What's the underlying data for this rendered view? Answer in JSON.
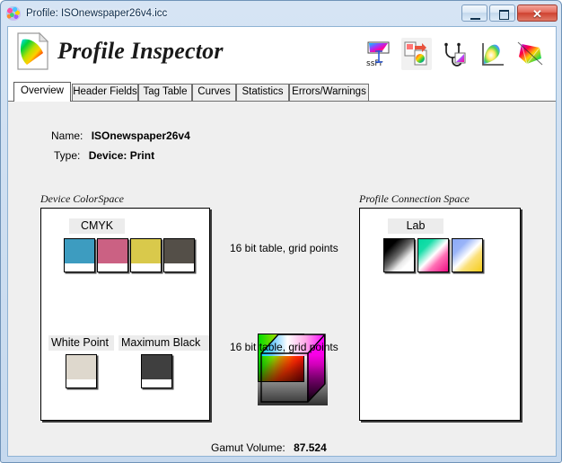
{
  "window": {
    "title": "Profile: ISOnewspaper26v4.icc",
    "icon": "brain-icon",
    "buttons": {
      "minimize": "minimize",
      "maximize": "maximize",
      "close": "✕"
    }
  },
  "header": {
    "app_title": "Profile Inspector",
    "logo_icon": "profile-document-gamut-icon",
    "toolbar": [
      {
        "name": "rgb-to-printer-icon",
        "label": "ssPr"
      },
      {
        "name": "profile-convert-icon",
        "label": ""
      },
      {
        "name": "stethoscope-inspect-icon",
        "label": ""
      },
      {
        "name": "chromaticity-plot-icon",
        "label": ""
      },
      {
        "name": "gamut-3d-icon",
        "label": ""
      }
    ]
  },
  "tabs": [
    {
      "label": "Overview",
      "active": true
    },
    {
      "label": "Header Fields",
      "active": false
    },
    {
      "label": "Tag Table",
      "active": false
    },
    {
      "label": "Curves",
      "active": false
    },
    {
      "label": "Statistics",
      "active": false
    },
    {
      "label": "Errors/Warnings",
      "active": false
    }
  ],
  "overview": {
    "fields": [
      {
        "key": "Name:",
        "value": "ISOnewspaper26v4"
      },
      {
        "key": "Type:",
        "value": "Device: Print"
      }
    ],
    "device_colorspace": {
      "group_label": "Device ColorSpace",
      "model_label": "CMYK",
      "channels": [
        {
          "name": "cyan-swatch",
          "color": "#3d9cc0"
        },
        {
          "name": "magenta-swatch",
          "color": "#cb6183"
        },
        {
          "name": "yellow-swatch",
          "color": "#d9c94b"
        },
        {
          "name": "black-swatch",
          "color": "#544f48"
        }
      ],
      "white_point": {
        "label": "White Point",
        "color": "#ded8cd"
      },
      "maximum_black": {
        "label": "Maximum Black",
        "color": "#3f3f3f"
      }
    },
    "center": {
      "top_text": "16 bit table,  grid points",
      "bottom_text": "16 bit table,  grid points",
      "cube_icon": "color-cube-icon"
    },
    "pcs": {
      "group_label": "Profile Connection Space",
      "model_label": "Lab",
      "channels": [
        {
          "name": "lab-l-swatch",
          "from": "#000000",
          "to": "#ffffff"
        },
        {
          "name": "lab-a-swatch",
          "from": "#00d9a0",
          "to": "#ef0d85"
        },
        {
          "name": "lab-b-swatch",
          "from": "#8aa9f7",
          "to": "#f5cc18"
        }
      ]
    },
    "gamut": {
      "label": "Gamut Volume:",
      "value": "87.524"
    }
  }
}
